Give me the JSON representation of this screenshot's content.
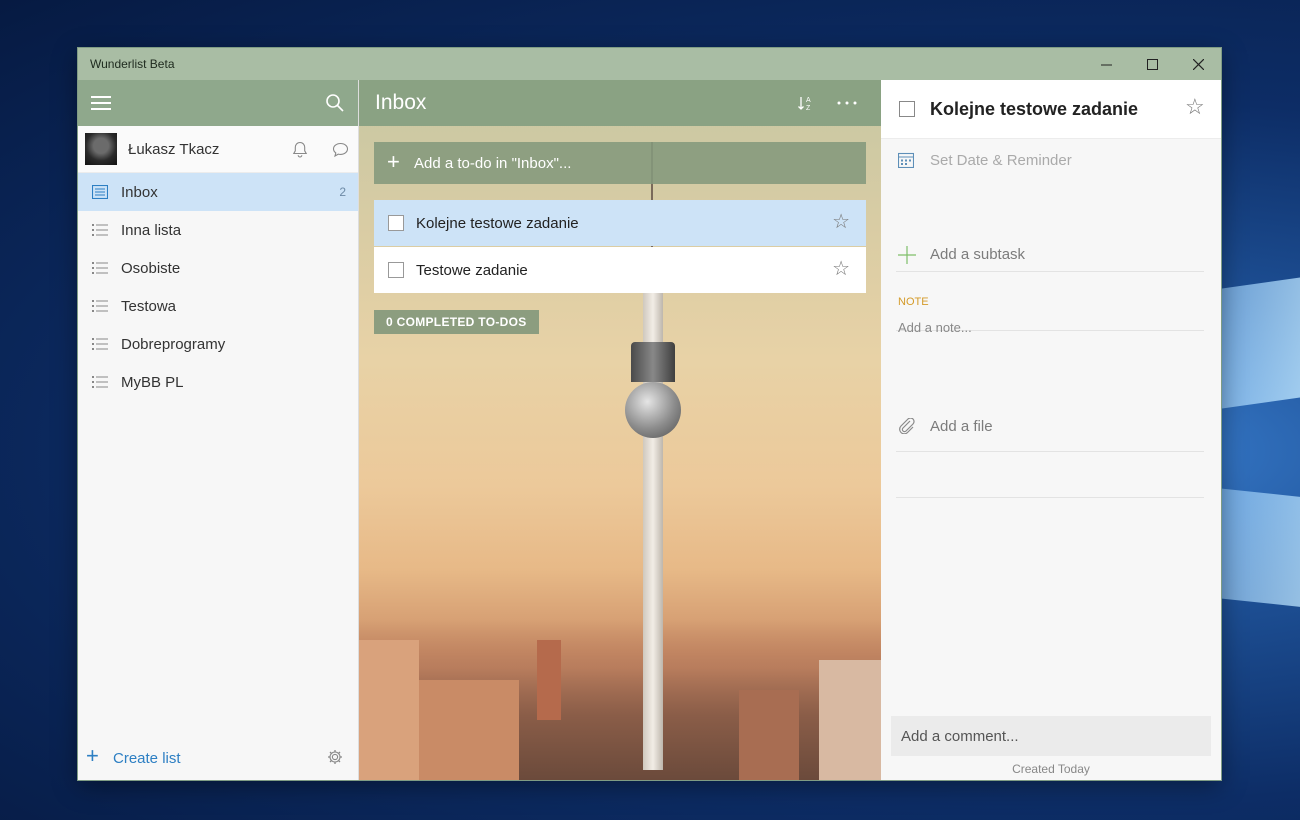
{
  "window": {
    "title": "Wunderlist Beta"
  },
  "sidebar": {
    "user_name": "Łukasz Tkacz",
    "lists": [
      {
        "label": "Inbox",
        "count": "2",
        "icon": "inbox-icon"
      },
      {
        "label": "Inna lista",
        "icon": "list-icon"
      },
      {
        "label": "Osobiste",
        "icon": "list-icon"
      },
      {
        "label": "Testowa",
        "icon": "list-icon"
      },
      {
        "label": "Dobreprogramy",
        "icon": "list-icon"
      },
      {
        "label": "MyBB PL",
        "icon": "list-icon"
      }
    ],
    "create_list": "Create list"
  },
  "main": {
    "title": "Inbox",
    "add_todo_placeholder": "Add a to-do in \"Inbox\"...",
    "tasks": [
      {
        "label": "Kolejne testowe zadanie"
      },
      {
        "label": "Testowe zadanie"
      }
    ],
    "completed_label": "0 COMPLETED TO-DOS"
  },
  "details": {
    "title": "Kolejne testowe zadanie",
    "set_date": "Set Date & Reminder",
    "add_subtask": "Add a subtask",
    "note_header": "NOTE",
    "note_placeholder": "Add a note...",
    "add_file": "Add a file",
    "comment_placeholder": "Add a comment...",
    "created": "Created Today"
  },
  "colors": {
    "accent_green": "#8fa88c",
    "selection_blue": "#cde3f7",
    "link_blue": "#2d7fc3",
    "note_orange": "#d49b2a"
  }
}
